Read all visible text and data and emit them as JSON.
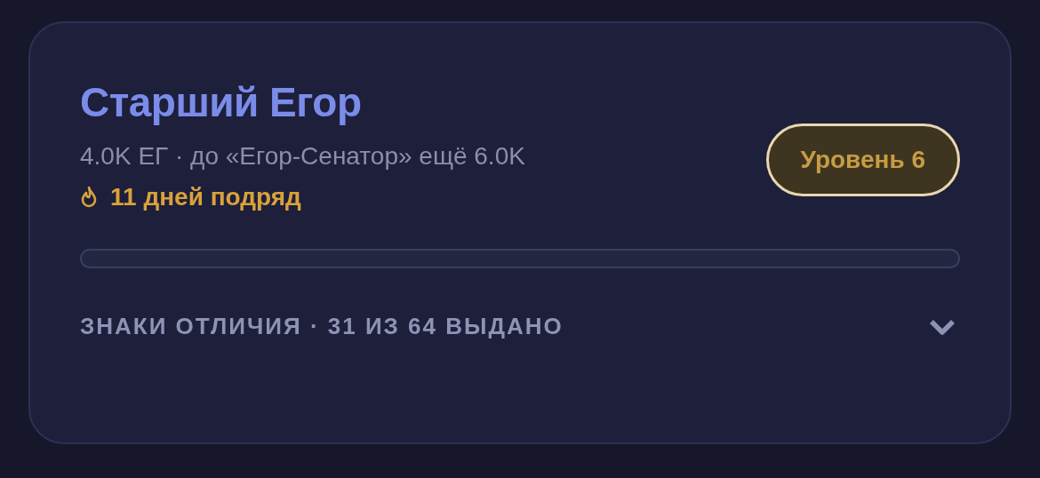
{
  "profile": {
    "title": "Старший Егор",
    "subtitle": "4.0K ЕГ · до «Егор-Сенатор» ещё 6.0K",
    "streak": "11 дней подряд",
    "level_badge": "Уровень 6"
  },
  "progress": {
    "level": 0
  },
  "badges_section": {
    "label": "ЗНАКИ ОТЛИЧИЯ · 31 ИЗ 64 ВЫДАНО",
    "expanded": false
  }
}
